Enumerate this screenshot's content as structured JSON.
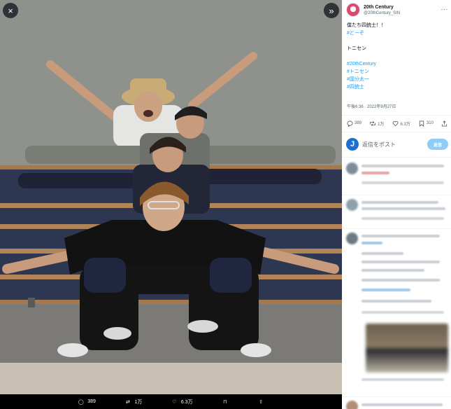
{
  "viewer": {
    "close_icon": "×",
    "expand_icon": "»",
    "actions": [
      {
        "icon": "reply-icon",
        "glyph": "◯",
        "count": "389"
      },
      {
        "icon": "retweet-icon",
        "glyph": "⇄",
        "count": "1万"
      },
      {
        "icon": "heart-icon",
        "glyph": "♡",
        "count": "6.3万"
      },
      {
        "icon": "bookmark-icon",
        "glyph": "⊓",
        "count": ""
      },
      {
        "icon": "share-icon",
        "glyph": "⇧",
        "count": ""
      }
    ]
  },
  "author": {
    "name": "20th Century",
    "handle": "@20thCentury_SIN",
    "more": "···"
  },
  "tweet": {
    "line1": "僕たち四銃士！！",
    "line2": "#どーぞ",
    "line3": "トニセン",
    "tags": [
      "#20thCentury",
      "#トニセン",
      "#国分太一",
      "#四銃士"
    ]
  },
  "timestamp": "午後6:36 · 2022年9月27日",
  "stats": {
    "replies": "389",
    "retweets": "1万",
    "likes": "6.3万",
    "bookmarks": "310"
  },
  "reply_bar": {
    "avatar_letter": "J",
    "placeholder": "返信をポスト",
    "button": "返信"
  },
  "colors": {
    "accent": "#1d9bf0",
    "reply_button": "#8ecdf8",
    "muted": "#536471",
    "text": "#0f1419"
  }
}
